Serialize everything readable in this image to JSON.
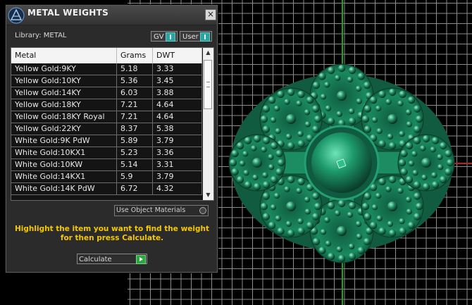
{
  "colors": {
    "accent_toggle": "#2aa3a3",
    "instruction_text": "#f5c800",
    "model_green": "#1f8a62",
    "grid": "#8c8c8c"
  },
  "panel": {
    "title": "METAL WEIGHTS",
    "close_icon": "close-icon",
    "library_label": "Library: METAL",
    "toggles": {
      "gv": "GV",
      "user": "User"
    },
    "table": {
      "headers": {
        "metal": "Metal",
        "grams": "Grams",
        "dwt": "DWT"
      },
      "rows": [
        {
          "metal": "Yellow Gold:9KY",
          "grams": "5.18",
          "dwt": "3.33"
        },
        {
          "metal": "Yellow Gold:10KY",
          "grams": "5.36",
          "dwt": "3.45"
        },
        {
          "metal": "Yellow Gold:14KY",
          "grams": "6.03",
          "dwt": "3.88"
        },
        {
          "metal": "Yellow Gold:18KY",
          "grams": "7.21",
          "dwt": "4.64"
        },
        {
          "metal": "Yellow Gold:18KY Royal",
          "grams": "7.21",
          "dwt": "4.64"
        },
        {
          "metal": "Yellow Gold:22KY",
          "grams": "8.37",
          "dwt": "5.38"
        },
        {
          "metal": "White Gold:9K PdW",
          "grams": "5.89",
          "dwt": "3.79"
        },
        {
          "metal": "White Gold:10KX1",
          "grams": "5.23",
          "dwt": "3.36"
        },
        {
          "metal": "White Gold:10KW",
          "grams": "5.14",
          "dwt": "3.31"
        },
        {
          "metal": "White Gold:14KX1",
          "grams": "5.9",
          "dwt": "3.79"
        },
        {
          "metal": "White Gold:14K PdW",
          "grams": "6.72",
          "dwt": "4.32"
        }
      ]
    },
    "use_object_materials": "Use Object Materials",
    "instruction": "Highlight the item you want to find the weight for then press Calculate.",
    "calculate_label": "Calculate"
  }
}
